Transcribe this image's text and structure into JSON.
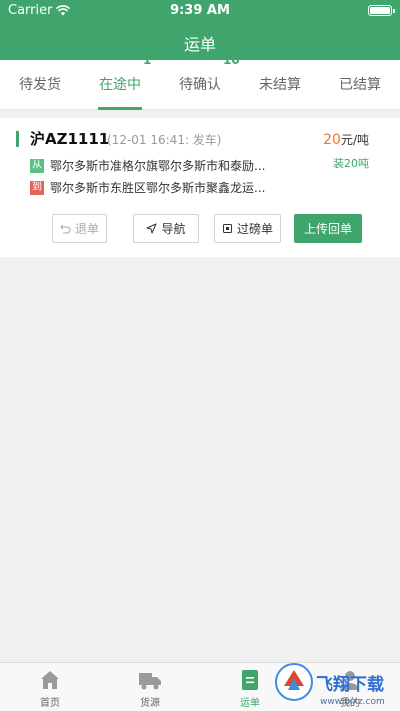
{
  "status_bar": {
    "carrier": "Carrier",
    "time": "9:39 AM"
  },
  "nav": {
    "title": "运单"
  },
  "tabs": [
    {
      "label": "待发货",
      "count": ""
    },
    {
      "label": "在途中",
      "count": "1"
    },
    {
      "label": "待确认",
      "count": "10"
    },
    {
      "label": "未结算",
      "count": ""
    },
    {
      "label": "已结算",
      "count": ""
    }
  ],
  "order": {
    "plate": "沪AZ1111",
    "depart_time": "(12-01 16:41: 发车)",
    "price_value": "20",
    "price_unit": "元/吨",
    "load": "装20吨",
    "from_tag": "从",
    "from_address": "鄂尔多斯市准格尔旗鄂尔多斯市和泰励...",
    "to_tag": "到",
    "to_address": "鄂尔多斯市东胜区鄂尔多斯市聚鑫龙运...",
    "buttons": {
      "return": "退单",
      "navigate": "导航",
      "weigh": "过磅单",
      "upload": "上传回单"
    }
  },
  "bottom_nav": [
    {
      "label": "首页",
      "icon": "home-icon"
    },
    {
      "label": "货源",
      "icon": "truck-icon"
    },
    {
      "label": "运单",
      "icon": "waybill-icon"
    },
    {
      "label": "我的",
      "icon": "user-icon"
    }
  ],
  "watermark": {
    "text": "飞翔下载",
    "url": "www.fxxz.com"
  },
  "colors": {
    "accent": "#3fa56d",
    "price": "#ef7b2a",
    "to_tag": "#e2645b"
  }
}
